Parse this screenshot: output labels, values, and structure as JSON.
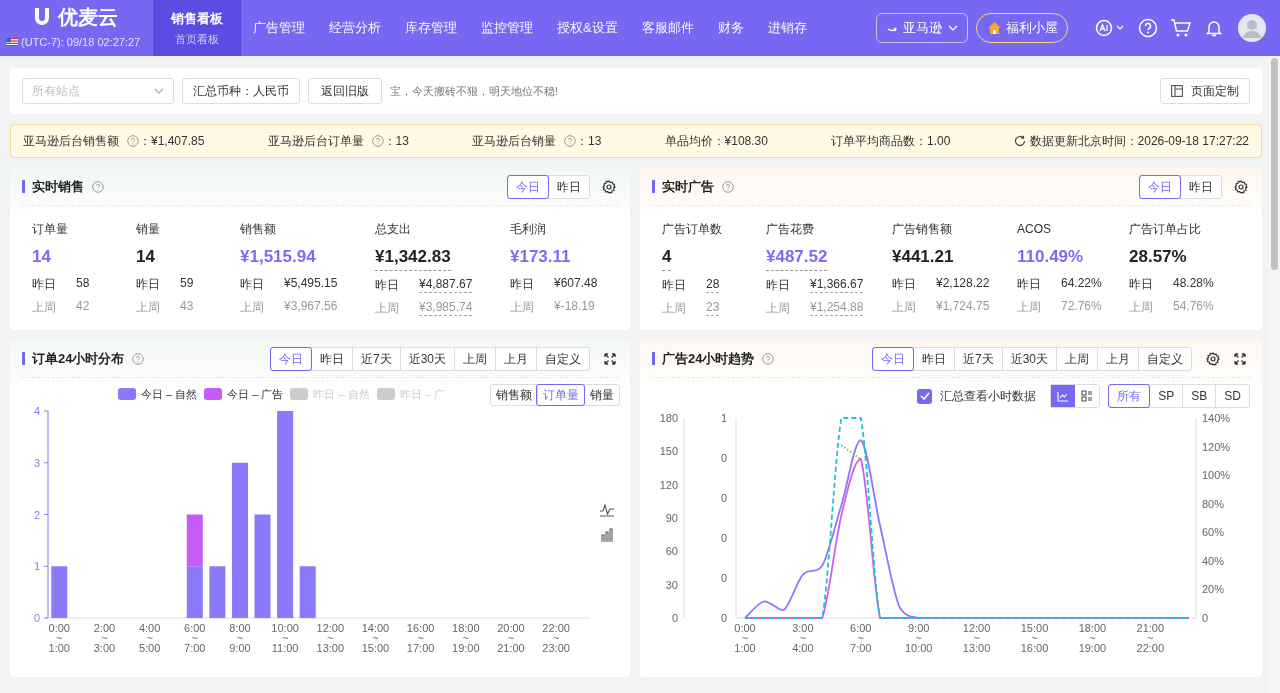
{
  "header": {
    "logo": "优麦云",
    "clock": "(UTC-7): 09/18 02:27:27",
    "nav": [
      {
        "label": "销售看板",
        "sub": "首页看板",
        "selected": true
      },
      {
        "label": "广告管理",
        "selected": false
      },
      {
        "label": "经营分析",
        "selected": false
      },
      {
        "label": "库存管理",
        "selected": false
      },
      {
        "label": "监控管理",
        "selected": false
      },
      {
        "label": "授权&设置",
        "selected": false
      },
      {
        "label": "客服邮件",
        "selected": false
      },
      {
        "label": "财务",
        "selected": false
      },
      {
        "label": "进销存",
        "selected": false
      }
    ],
    "platform": "亚马逊",
    "perk": "福利小屋"
  },
  "filters": {
    "site_placeholder": "所有站点",
    "currency": "汇总币种：人民币",
    "legacy": "返回旧版",
    "slogan": "宝，今天搬砖不狠，明天地位不稳!",
    "customize": "页面定制"
  },
  "summary": {
    "items": [
      {
        "label": "亚马逊后台销售额",
        "help": true,
        "value": "：¥1,407.85"
      },
      {
        "label": "亚马逊后台订单量",
        "help": true,
        "value": "：13"
      },
      {
        "label": "亚马逊后台销量",
        "help": true,
        "value": "：13"
      },
      {
        "label": "单品均价",
        "help": false,
        "value": "：¥108.30"
      },
      {
        "label": "订单平均商品数",
        "help": false,
        "value": "：1.00"
      }
    ],
    "updated": "数据更新北京时间：2026-09-18 17:27:22"
  },
  "realtime_sales": {
    "title": "实时销售",
    "tabs": [
      {
        "label": "今日",
        "selected": true
      },
      {
        "label": "昨日",
        "selected": false
      }
    ],
    "metrics": [
      {
        "label": "订单量",
        "value": "14",
        "accent": true,
        "underlined": false,
        "rows": [
          {
            "label": "昨日",
            "value": "58",
            "muted": false,
            "underlined": false
          },
          {
            "label": "上周",
            "value": "42",
            "muted": true,
            "underlined": false
          }
        ]
      },
      {
        "label": "销量",
        "value": "14",
        "accent": false,
        "underlined": false,
        "rows": [
          {
            "label": "昨日",
            "value": "59",
            "muted": false,
            "underlined": false
          },
          {
            "label": "上周",
            "value": "43",
            "muted": true,
            "underlined": false
          }
        ]
      },
      {
        "label": "销售额",
        "value": "¥1,515.94",
        "accent": true,
        "underlined": false,
        "rows": [
          {
            "label": "昨日",
            "value": "¥5,495.15",
            "muted": false,
            "underlined": false
          },
          {
            "label": "上周",
            "value": "¥3,967.56",
            "muted": true,
            "underlined": false
          }
        ]
      },
      {
        "label": "总支出",
        "value": "¥1,342.83",
        "accent": false,
        "underlined": true,
        "rows": [
          {
            "label": "昨日",
            "value": "¥4,887.67",
            "muted": false,
            "underlined": true
          },
          {
            "label": "上周",
            "value": "¥3,985.74",
            "muted": true,
            "underlined": true
          }
        ]
      },
      {
        "label": "毛利润",
        "value": "¥173.11",
        "accent": true,
        "underlined": false,
        "rows": [
          {
            "label": "昨日",
            "value": "¥607.48",
            "muted": false,
            "underlined": false
          },
          {
            "label": "上周",
            "value": "¥-18.19",
            "muted": true,
            "underlined": false
          }
        ]
      }
    ]
  },
  "realtime_ads": {
    "title": "实时广告",
    "tabs": [
      {
        "label": "今日",
        "selected": true
      },
      {
        "label": "昨日",
        "selected": false
      }
    ],
    "metrics": [
      {
        "label": "广告订单数",
        "value": "4",
        "accent": false,
        "underlined": true,
        "rows": [
          {
            "label": "昨日",
            "value": "28",
            "muted": false,
            "underlined": true
          },
          {
            "label": "上周",
            "value": "23",
            "muted": true,
            "underlined": true
          }
        ]
      },
      {
        "label": "广告花费",
        "value": "¥487.52",
        "accent": true,
        "underlined": true,
        "rows": [
          {
            "label": "昨日",
            "value": "¥1,366.67",
            "muted": false,
            "underlined": true
          },
          {
            "label": "上周",
            "value": "¥1,254.88",
            "muted": true,
            "underlined": true
          }
        ]
      },
      {
        "label": "广告销售额",
        "value": "¥441.21",
        "accent": false,
        "underlined": false,
        "rows": [
          {
            "label": "昨日",
            "value": "¥2,128.22",
            "muted": false,
            "underlined": false
          },
          {
            "label": "上周",
            "value": "¥1,724.75",
            "muted": true,
            "underlined": false
          }
        ]
      },
      {
        "label": "ACOS",
        "value": "110.49%",
        "accent": true,
        "underlined": false,
        "rows": [
          {
            "label": "昨日",
            "value": "64.22%",
            "muted": false,
            "underlined": false
          },
          {
            "label": "上周",
            "value": "72.76%",
            "muted": true,
            "underlined": false
          }
        ]
      },
      {
        "label": "广告订单占比",
        "value": "28.57%",
        "accent": false,
        "underlined": false,
        "rows": [
          {
            "label": "昨日",
            "value": "48.28%",
            "muted": false,
            "underlined": false
          },
          {
            "label": "上周",
            "value": "54.76%",
            "muted": true,
            "underlined": false
          }
        ]
      }
    ]
  },
  "order_distribution": {
    "title": "订单24小时分布",
    "ranges": [
      {
        "label": "今日",
        "selected": true
      },
      {
        "label": "昨日",
        "selected": false
      },
      {
        "label": "近7天",
        "selected": false
      },
      {
        "label": "近30天",
        "selected": false
      },
      {
        "label": "上周",
        "selected": false
      },
      {
        "label": "上月",
        "selected": false
      },
      {
        "label": "自定义",
        "selected": false
      }
    ],
    "legend": [
      {
        "label": "今日 – 自然",
        "color": "#8a79f8",
        "disabled": false
      },
      {
        "label": "今日 – 广告",
        "color": "#c45cf6",
        "disabled": false
      },
      {
        "label": "昨日 – 自然",
        "color": "#cccccc",
        "disabled": true
      },
      {
        "label": "昨日 – 广",
        "color": "#cccccc",
        "disabled": true
      }
    ],
    "measures": [
      {
        "label": "销售额",
        "selected": false
      },
      {
        "label": "订单量",
        "selected": true
      },
      {
        "label": "销量",
        "selected": false
      }
    ],
    "chart_data": {
      "type": "bar",
      "stacked": true,
      "categories": [
        "0:00\n~\n1:00",
        null,
        "2:00\n~\n3:00",
        null,
        "4:00\n~\n5:00",
        null,
        "6:00\n~\n7:00",
        null,
        "8:00\n~\n9:00",
        null,
        "10:00\n~\n11:00",
        null,
        "12:00\n~\n13:00",
        null,
        "14:00\n~\n15:00",
        null,
        "16:00\n~\n17:00",
        null,
        "18:00\n~\n19:00",
        null,
        "20:00\n~\n21:00",
        null,
        "22:00\n~\n23:00",
        null
      ],
      "series": [
        {
          "color": "#8a79f8",
          "values": [
            1,
            0,
            0,
            0,
            0,
            0,
            1,
            1,
            3,
            2,
            4,
            1,
            0,
            0,
            0,
            0,
            0,
            0,
            0,
            0,
            0,
            0,
            0,
            0
          ]
        },
        {
          "color": "#c45cf6",
          "values": [
            0,
            0,
            0,
            0,
            0,
            0,
            1,
            0,
            0,
            0,
            0,
            0,
            0,
            0,
            0,
            0,
            0,
            0,
            0,
            0,
            0,
            0,
            0,
            0
          ]
        }
      ],
      "ylim": [
        0,
        4
      ],
      "yticks": [
        0,
        1,
        2,
        3,
        4
      ]
    }
  },
  "ad_trend": {
    "title": "广告24小时趋势",
    "ranges": [
      {
        "label": "今日",
        "selected": true
      },
      {
        "label": "昨日",
        "selected": false
      },
      {
        "label": "近7天",
        "selected": false
      },
      {
        "label": "近30天",
        "selected": false
      },
      {
        "label": "上周",
        "selected": false
      },
      {
        "label": "上月",
        "selected": false
      },
      {
        "label": "自定义",
        "selected": false
      }
    ],
    "hourly_summary": {
      "label": "汇总查看小时数据",
      "checked": true
    },
    "views": [
      {
        "kind": "line",
        "selected": true
      },
      {
        "kind": "list",
        "selected": false
      }
    ],
    "ad_types": [
      {
        "label": "所有",
        "selected": true
      },
      {
        "label": "SP",
        "selected": false
      },
      {
        "label": "SB",
        "selected": false
      },
      {
        "label": "SD",
        "selected": false
      }
    ],
    "middle_axis": [
      "1",
      "0",
      "0",
      "0",
      "0",
      "0"
    ],
    "chart_data": {
      "type": "line",
      "categories": [
        "0:00\n~\n1:00",
        null,
        null,
        "3:00\n~\n4:00",
        null,
        null,
        "6:00\n~\n7:00",
        null,
        null,
        "9:00\n~\n10:00",
        null,
        null,
        "12:00\n~\n13:00",
        null,
        null,
        "15:00\n~\n16:00",
        null,
        null,
        "18:00\n~\n19:00",
        null,
        null,
        "21:00\n~\n22:00",
        null,
        null
      ],
      "series": [
        {
          "color": "#8a79f8",
          "line_style": "solid",
          "values": [
            0,
            15,
            7,
            39,
            47,
            102,
            160,
            83,
            10,
            0,
            0,
            0,
            0,
            0,
            0,
            0,
            0,
            0,
            0,
            0,
            0,
            0,
            0,
            0
          ]
        },
        {
          "color": "#d65cf0",
          "line_style": "solid",
          "values": [
            0,
            0,
            0,
            0,
            0,
            93,
            143,
            0,
            0,
            0,
            0,
            0,
            0,
            0,
            0,
            0,
            0,
            0,
            0,
            0,
            0,
            0,
            0,
            0
          ]
        },
        {
          "color": "#1cc3cf",
          "axis": "y2",
          "line_style": "dashed",
          "values": [
            0,
            0,
            0,
            0,
            0,
            140,
            140,
            0,
            0,
            0,
            0,
            0,
            0,
            0,
            0,
            0,
            0,
            0,
            0,
            0,
            0,
            0,
            0,
            0
          ]
        },
        {
          "color": "#6cc91e",
          "axis": "y2",
          "line_style": "dotted",
          "values": [
            null,
            null,
            null,
            null,
            null,
            121,
            111,
            null,
            null,
            null,
            null,
            null,
            null,
            null,
            null,
            null,
            null,
            null,
            null,
            null,
            null,
            null,
            null,
            null
          ]
        }
      ],
      "ylim": [
        0,
        180
      ],
      "yticks": [
        0,
        30,
        60,
        90,
        120,
        150,
        180
      ],
      "y2lim": [
        0,
        140
      ],
      "y2ticks": [
        {
          "value": 0,
          "label": "0"
        },
        {
          "value": 20,
          "label": "20%"
        },
        {
          "value": 40,
          "label": "40%"
        },
        {
          "value": 60,
          "label": "60%"
        },
        {
          "value": 80,
          "label": "80%"
        },
        {
          "value": 100,
          "label": "100%"
        },
        {
          "value": 120,
          "label": "120%"
        },
        {
          "value": 140,
          "label": "140%"
        }
      ]
    }
  }
}
